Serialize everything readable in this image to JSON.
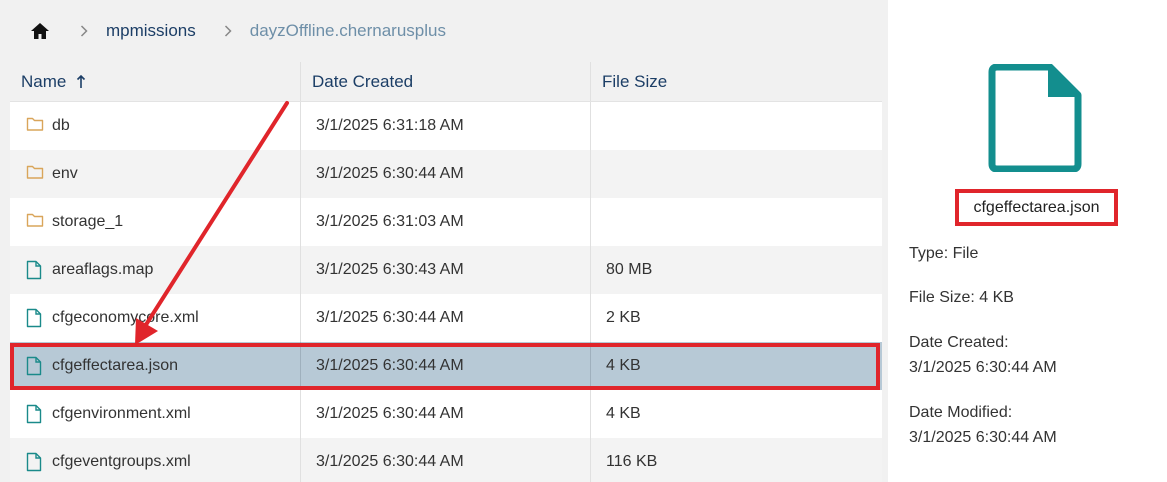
{
  "breadcrumb": {
    "home_icon": "home-icon",
    "items": [
      {
        "label": "mpmissions"
      },
      {
        "label": "dayzOffline.chernarusplus"
      }
    ]
  },
  "table": {
    "columns": {
      "name": "Name",
      "date": "Date Created",
      "size": "File Size"
    },
    "sort_indicator": "↑",
    "rows": [
      {
        "name": "db",
        "date": "3/1/2025 6:31:18 AM",
        "size": "",
        "type": "folder"
      },
      {
        "name": "env",
        "date": "3/1/2025 6:30:44 AM",
        "size": "",
        "type": "folder"
      },
      {
        "name": "storage_1",
        "date": "3/1/2025 6:31:03 AM",
        "size": "",
        "type": "folder"
      },
      {
        "name": "areaflags.map",
        "date": "3/1/2025 6:30:43 AM",
        "size": "80 MB",
        "type": "file"
      },
      {
        "name": "cfgeconomycore.xml",
        "date": "3/1/2025 6:30:44 AM",
        "size": "2 KB",
        "type": "file"
      },
      {
        "name": "cfgeffectarea.json",
        "date": "3/1/2025 6:30:44 AM",
        "size": "4 KB",
        "type": "file",
        "selected": true
      },
      {
        "name": "cfgenvironment.xml",
        "date": "3/1/2025 6:30:44 AM",
        "size": "4 KB",
        "type": "file"
      },
      {
        "name": "cfgeventgroups.xml",
        "date": "3/1/2025 6:30:44 AM",
        "size": "116 KB",
        "type": "file"
      }
    ]
  },
  "details": {
    "name": "cfgeffectarea.json",
    "type_line": "Type: File",
    "size_line": "File Size: 4 KB",
    "created_label": "Date Created:",
    "created_value": "3/1/2025 6:30:44 AM",
    "modified_label": "Date Modified:",
    "modified_value": "3/1/2025 6:30:44 AM"
  },
  "colors": {
    "folder_icon": "#d9a55a",
    "file_icon": "#1a8a8a",
    "big_file_icon": "#138e8e",
    "selected_row": "#b7c9d6",
    "highlight": "#e0252b",
    "link": "#1c3e66",
    "breadcrumb_current": "#6e8fa8"
  }
}
